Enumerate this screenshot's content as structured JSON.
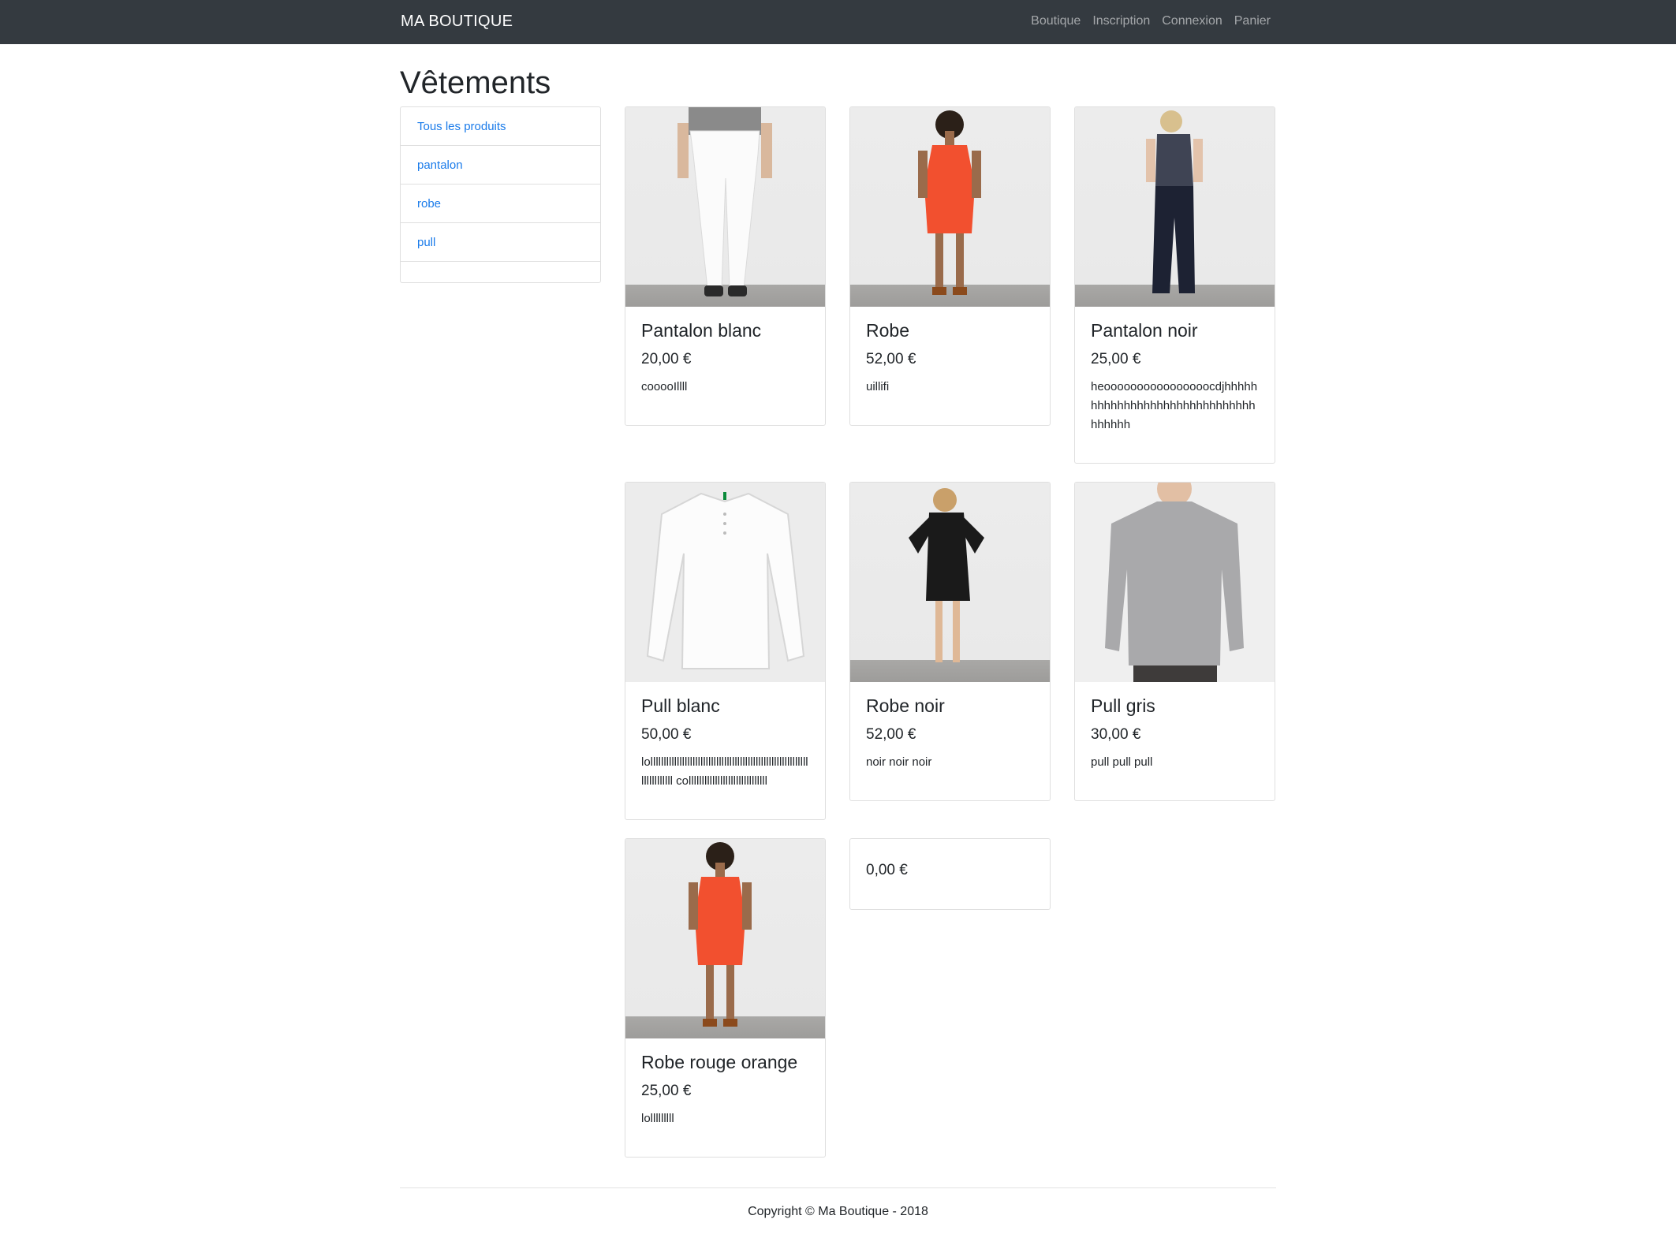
{
  "navbar": {
    "brand": "MA BOUTIQUE",
    "links": [
      "Boutique",
      "Inscription",
      "Connexion",
      "Panier"
    ]
  },
  "page": {
    "title": "Vêtements"
  },
  "sidebar": {
    "items": [
      {
        "label": "Tous les produits"
      },
      {
        "label": "pantalon"
      },
      {
        "label": "robe"
      },
      {
        "label": "pull"
      }
    ]
  },
  "products": [
    {
      "title": "Pantalon blanc",
      "price": "20,00 €",
      "description": "cooooIllll"
    },
    {
      "title": "Robe",
      "price": "52,00 €",
      "description": "uillifi"
    },
    {
      "title": "Pantalon noir",
      "price": "25,00 €",
      "description": "heoooooooooooooooocdjhhhhhhhhhhhhhhhhhhhhhhhhhhhhhhhhhhhh"
    },
    {
      "title": "Pull blanc",
      "price": "50,00 €",
      "description": "lollllllllllllllllllllllllllllllllllllllllllllllllllllllllllllllllllllllll collllllllllllllllllllllllllllll"
    },
    {
      "title": "Robe noir",
      "price": "52,00 €",
      "description": "noir noir noir"
    },
    {
      "title": "Pull gris",
      "price": "30,00 €",
      "description": "pull pull pull"
    },
    {
      "title": "Robe rouge orange",
      "price": "25,00 €",
      "description": "lolllllllll"
    },
    {
      "title": "",
      "price": "0,00 €",
      "description": ""
    }
  ],
  "footer": {
    "text": "Copyright © Ma Boutique - 2018"
  },
  "colors": {
    "navbar": "#343a40",
    "link": "#1a7bea",
    "border": "#dfdfdf"
  }
}
